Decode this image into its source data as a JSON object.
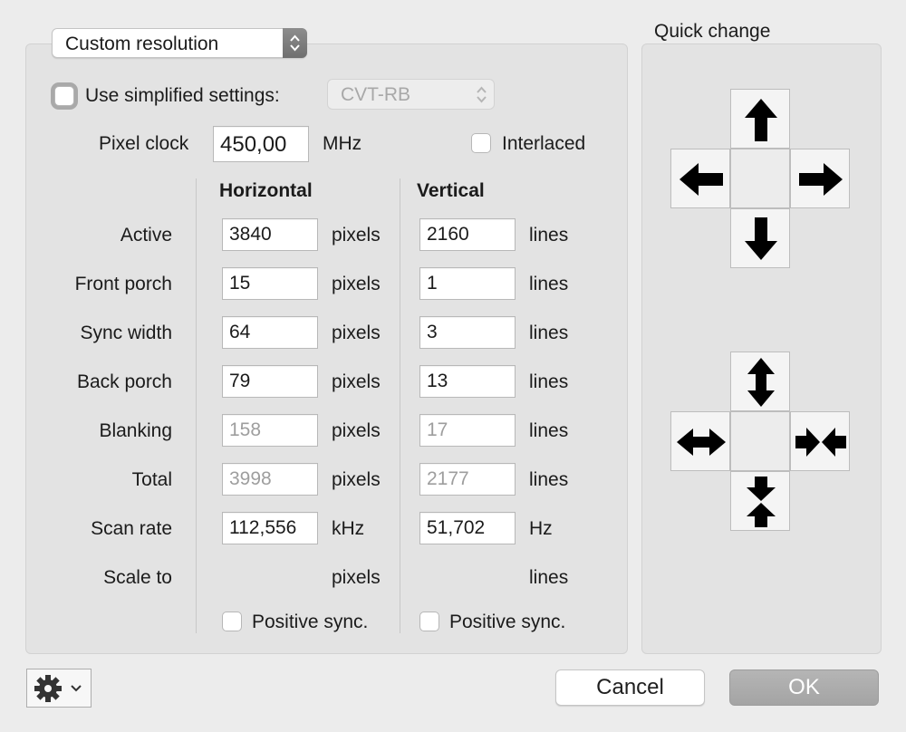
{
  "resolution_type": {
    "selected": "Custom resolution"
  },
  "simplified": {
    "label": "Use simplified settings:",
    "preset": "CVT-RB",
    "checked": false
  },
  "pixel_clock": {
    "label": "Pixel clock",
    "value": "450,00",
    "unit": "MHz"
  },
  "interlaced": {
    "label": "Interlaced",
    "checked": false
  },
  "columns": {
    "horizontal": "Horizontal",
    "vertical": "Vertical"
  },
  "rows": [
    {
      "label": "Active",
      "h_value": "3840",
      "h_unit": "pixels",
      "v_value": "2160",
      "v_unit": "lines",
      "editable": true
    },
    {
      "label": "Front porch",
      "h_value": "15",
      "h_unit": "pixels",
      "v_value": "1",
      "v_unit": "lines",
      "editable": true
    },
    {
      "label": "Sync width",
      "h_value": "64",
      "h_unit": "pixels",
      "v_value": "3",
      "v_unit": "lines",
      "editable": true
    },
    {
      "label": "Back porch",
      "h_value": "79",
      "h_unit": "pixels",
      "v_value": "13",
      "v_unit": "lines",
      "editable": true
    },
    {
      "label": "Blanking",
      "h_value": "158",
      "h_unit": "pixels",
      "v_value": "17",
      "v_unit": "lines",
      "editable": false
    },
    {
      "label": "Total",
      "h_value": "3998",
      "h_unit": "pixels",
      "v_value": "2177",
      "v_unit": "lines",
      "editable": false
    },
    {
      "label": "Scan rate",
      "h_value": "112,556",
      "h_unit": "kHz",
      "v_value": "51,702",
      "v_unit": "Hz",
      "editable": true
    },
    {
      "label": "Scale to",
      "h_value": "",
      "h_unit": "pixels",
      "v_value": "",
      "v_unit": "lines",
      "editable": false
    }
  ],
  "sync": {
    "horizontal_label": "Positive sync.",
    "vertical_label": "Positive sync.",
    "horizontal_checked": false,
    "vertical_checked": false
  },
  "quick_change": {
    "title": "Quick change",
    "move_icons": [
      "arrow-up-icon",
      "arrow-left-icon",
      "arrow-right-icon",
      "arrow-down-icon"
    ],
    "resize_icons": [
      "expand-vertical-icon",
      "expand-horizontal-icon",
      "shrink-horizontal-icon",
      "shrink-vertical-icon"
    ]
  },
  "footer": {
    "gear_icon": "gear-icon",
    "cancel_label": "Cancel",
    "ok_label": "OK"
  },
  "colors": {
    "window_bg": "#ececec",
    "panel_bg": "#e3e3e3",
    "disabled_text": "#9e9e9e",
    "ok_button": "#a9a9a9"
  }
}
